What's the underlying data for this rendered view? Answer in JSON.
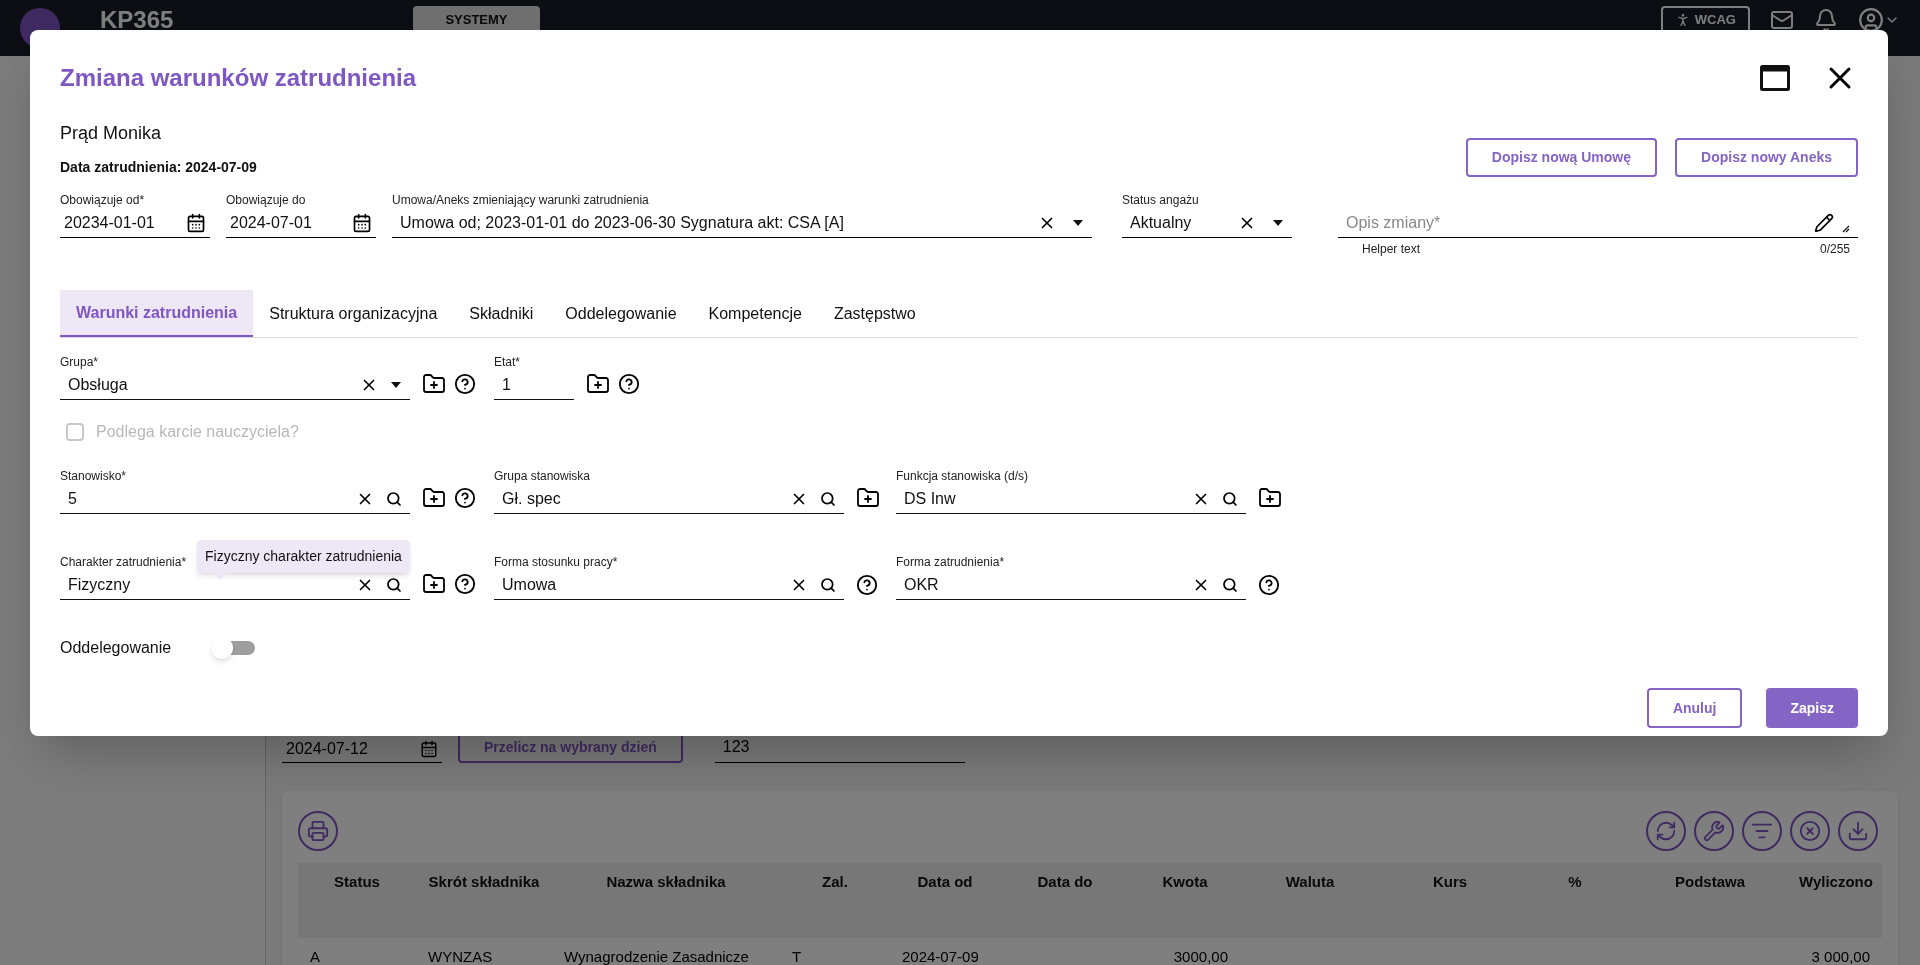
{
  "topbar": {
    "logo_text": "KP365",
    "tabs": [
      {
        "label": "SYSTEMY",
        "selected": true
      }
    ],
    "wcag_button": "WCAG"
  },
  "background": {
    "date_value": "2024-07-12",
    "recalc_button": "Przelicz na wybrany dzień",
    "value_field": "123",
    "table": {
      "columns": [
        "Status",
        "Skrót składnika",
        "Nazwa składnika",
        "Zal.",
        "Data od",
        "Data do",
        "Kwota",
        "Waluta",
        "Kurs",
        "%",
        "Podstawa",
        "Wyliczono"
      ],
      "rows": [
        [
          "A",
          "WYNZAS",
          "Wynagrodzenie Zasadnicze",
          "T",
          "2024-07-09",
          "",
          "3000,00",
          "",
          "",
          "",
          "",
          "3 000,00"
        ]
      ]
    }
  },
  "dialog": {
    "title": "Zmiana warunków zatrudnienia",
    "employee_name": "Prąd Monika",
    "hire_date": "Data zatrudnienia: 2024-07-09",
    "header_buttons": [
      "Dopisz nową Umowę",
      "Dopisz nowy Aneks"
    ],
    "header_fields": [
      {
        "kind": "date",
        "label": "Obowiązuje od*",
        "value": "20234-01-01"
      },
      {
        "kind": "date",
        "label": "Obowiązuje do",
        "value": "2024-07-01"
      },
      {
        "kind": "select",
        "label": "Umowa/Aneks zmieniający warunki zatrudnienia",
        "value": "Umowa od; 2023-01-01 do 2023-06-30 Sygnatura akt: CSA [A]"
      },
      {
        "kind": "select",
        "label": "Status angażu",
        "value": "Aktualny"
      },
      {
        "kind": "textarea",
        "placeholder": "Opis zmiany*",
        "helper": "Helper text",
        "counter": "0/255"
      }
    ],
    "tabs": [
      {
        "label": "Warunki zatrudnienia",
        "selected": true
      },
      {
        "label": "Struktura organizacyjna",
        "selected": false
      },
      {
        "label": "Składniki",
        "selected": false
      },
      {
        "label": "Oddelegowanie",
        "selected": false
      },
      {
        "label": "Kompetencje",
        "selected": false
      },
      {
        "label": "Zastępstwo",
        "selected": false
      }
    ],
    "row_1": [
      {
        "label": "Grupa*",
        "value": "Obsługa",
        "clearable": true,
        "kind": "dropdown",
        "add_button": true,
        "help_button": true
      },
      {
        "label": "Etat*",
        "value": "1",
        "clearable": false,
        "kind": "plain",
        "add_button": true,
        "help_button": true
      }
    ],
    "checkbox": {
      "label": "Podlega karcie nauczyciela?",
      "checked": false,
      "disabled": true
    },
    "row_2": [
      {
        "label": "Stanowisko*",
        "value": "5",
        "clearable": true,
        "kind": "search",
        "add_button": true,
        "help_button": true
      },
      {
        "label": "Grupa stanowiska",
        "value": "Gł. spec",
        "clearable": true,
        "kind": "search",
        "add_button": true,
        "help_button": false
      },
      {
        "label": "Funkcja stanowiska (d/s)",
        "value": "DS Inw",
        "clearable": true,
        "kind": "search",
        "add_button": true,
        "help_button": false
      }
    ],
    "row_3": [
      {
        "label": "Charakter zatrudnienia*",
        "value": "Fizyczny",
        "clearable": true,
        "kind": "search",
        "add_button": true,
        "help_button": true,
        "tooltip": "Fizyczny charakter zatrudnienia"
      },
      {
        "label": "Forma stosunku pracy*",
        "value": "Umowa",
        "clearable": true,
        "kind": "search",
        "add_button": false,
        "help_button": true
      },
      {
        "label": "Forma zatrudnienia*",
        "value": "OKR",
        "clearable": true,
        "kind": "search",
        "add_button": false,
        "help_button": true
      }
    ],
    "toggle": {
      "label": "Oddelegowanie",
      "on": false
    },
    "footer_buttons": [
      {
        "label": "Anuluj",
        "kind": "outline"
      },
      {
        "label": "Zapisz",
        "kind": "primary"
      }
    ]
  }
}
